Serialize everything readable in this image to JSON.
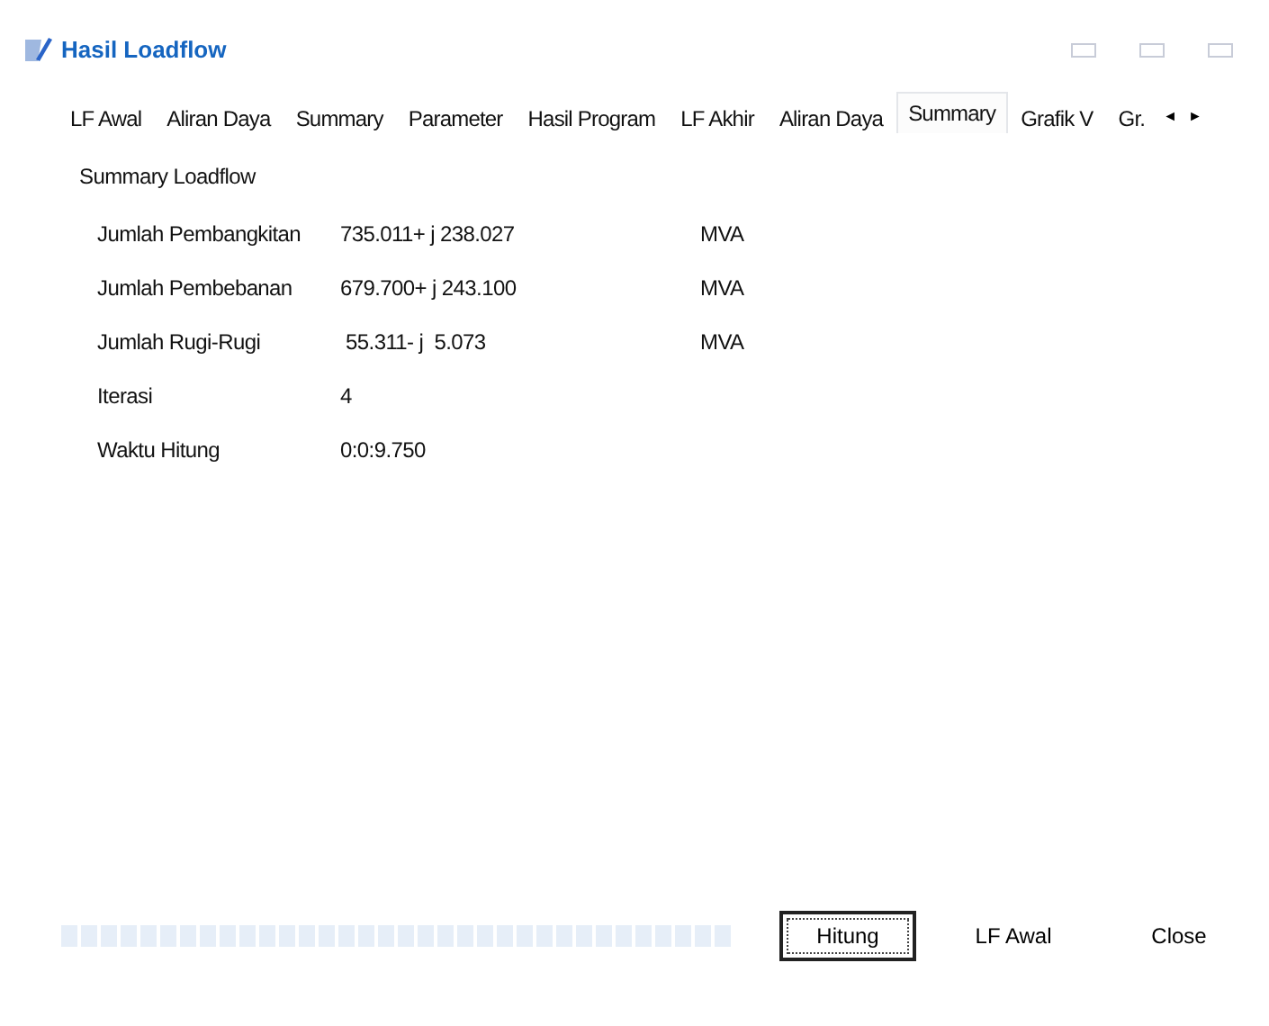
{
  "window": {
    "title": "Hasil Loadflow"
  },
  "tabs": [
    {
      "label": "LF Awal",
      "selected": false
    },
    {
      "label": "Aliran Daya",
      "selected": false
    },
    {
      "label": "Summary",
      "selected": false
    },
    {
      "label": "Parameter",
      "selected": false
    },
    {
      "label": "Hasil Program",
      "selected": false
    },
    {
      "label": "LF Akhir",
      "selected": false
    },
    {
      "label": "Aliran Daya",
      "selected": false
    },
    {
      "label": "Summary",
      "selected": true
    },
    {
      "label": "Grafik V",
      "selected": false
    },
    {
      "label": "Gr.",
      "selected": false
    }
  ],
  "tab_scroll": [
    "◄",
    "►"
  ],
  "panel": {
    "title": "Summary Loadflow",
    "rows": [
      {
        "label": "Jumlah Pembangkitan",
        "value": "735.011+ j 238.027",
        "unit": "MVA"
      },
      {
        "label": "Jumlah Pembebanan",
        "value": "679.700+ j 243.100",
        "unit": "MVA"
      },
      {
        "label": "Jumlah Rugi-Rugi",
        "value": " 55.311- j  5.073",
        "unit": "MVA"
      },
      {
        "label": "Iterasi",
        "value": "4"
      },
      {
        "label": "Waktu Hitung",
        "value": "0:0:9.750"
      }
    ]
  },
  "progress": {
    "level": 1
  },
  "buttons": [
    {
      "label": "Hitung",
      "focused": true
    },
    {
      "label": "LF Awal",
      "focused": false
    },
    {
      "label": "Close",
      "focused": false
    }
  ]
}
